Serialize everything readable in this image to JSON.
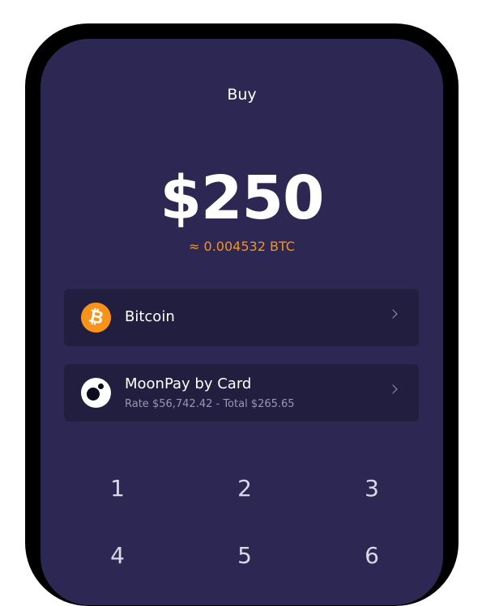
{
  "header": {
    "title": "Buy"
  },
  "amount": {
    "fiat": "$250",
    "crypto": "≈ 0.004532 BTC"
  },
  "asset_row": {
    "label": "Bitcoin",
    "icon": "bitcoin-icon",
    "icon_glyph": "₿"
  },
  "provider_row": {
    "label": "MoonPay by Card",
    "sub": "Rate $56,742.42 - Total $265.65",
    "icon": "moonpay-icon"
  },
  "keypad": {
    "keys": [
      "1",
      "2",
      "3",
      "4",
      "5",
      "6"
    ]
  },
  "colors": {
    "background": "#2d2753",
    "row": "#221e3f",
    "accent": "#f7931a"
  }
}
